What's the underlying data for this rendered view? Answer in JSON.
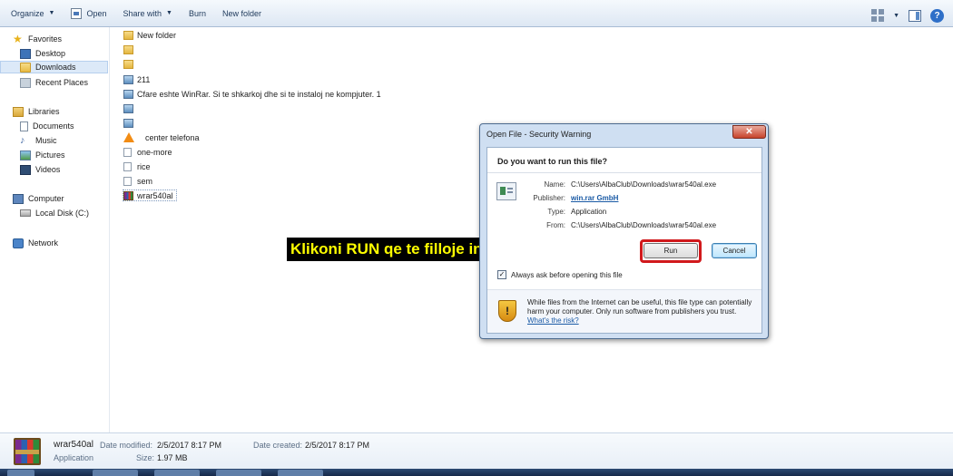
{
  "toolbar": {
    "organize": "Organize",
    "open": "Open",
    "share_with": "Share with",
    "burn": "Burn",
    "new_folder": "New folder",
    "help": "?"
  },
  "nav": {
    "favorites": "Favorites",
    "desktop": "Desktop",
    "downloads": "Downloads",
    "recent_places": "Recent Places",
    "libraries": "Libraries",
    "documents": "Documents",
    "music": "Music",
    "pictures": "Pictures",
    "videos": "Videos",
    "computer": "Computer",
    "local_disk": "Local Disk (C:)",
    "network": "Network"
  },
  "files": [
    {
      "name": "New folder",
      "type": "folder"
    },
    {
      "name": "",
      "type": "folder"
    },
    {
      "name": "",
      "type": "folder"
    },
    {
      "name": "211",
      "type": "image"
    },
    {
      "name": "Cfare eshte WinRar. Si te shkarkoj dhe si te instaloj ne kompjuter. 1",
      "type": "image"
    },
    {
      "name": "",
      "type": "image"
    },
    {
      "name": "",
      "type": "image"
    },
    {
      "name": "center telefona",
      "type": "vlc"
    },
    {
      "name": "one-more",
      "type": "file"
    },
    {
      "name": "rice",
      "type": "file"
    },
    {
      "name": "sem",
      "type": "file"
    },
    {
      "name": "wrar540al",
      "type": "rar"
    }
  ],
  "details": {
    "name": "wrar540al",
    "type": "Application",
    "date_modified_label": "Date modified:",
    "date_modified": "2/5/2017 8:17 PM",
    "size_label": "Size:",
    "size": "1.97 MB",
    "date_created_label": "Date created:",
    "date_created": "2/5/2017 8:17 PM"
  },
  "dialog": {
    "title": "Open File - Security Warning",
    "close": "✕",
    "question": "Do you want to run this file?",
    "fields": {
      "name_label": "Name:",
      "name": "C:\\Users\\AlbaClub\\Downloads\\wrar540al.exe",
      "publisher_label": "Publisher:",
      "publisher": "win.rar GmbH",
      "type_label": "Type:",
      "type": "Application",
      "from_label": "From:",
      "from": "C:\\Users\\AlbaClub\\Downloads\\wrar540al.exe"
    },
    "run": "Run",
    "cancel": "Cancel",
    "checkbox_checked": "✓",
    "checkbox_label": "Always ask before opening this file",
    "warning": "While files from the Internet can be useful, this file type can potentially harm your computer. Only run software from publishers you trust.",
    "warning_link": "What's the risk?"
  },
  "annotation": {
    "text": "Klikoni RUN qe te filloje instalimi",
    "accent": "#d1191c",
    "text_color": "#ffff00"
  },
  "shield_mark": "!"
}
